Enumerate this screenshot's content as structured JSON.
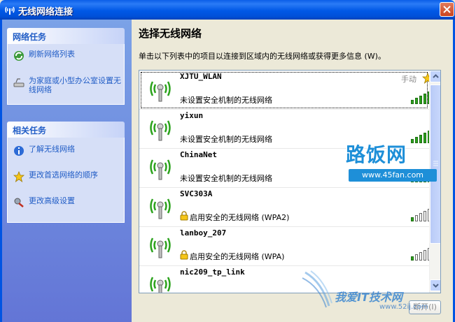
{
  "window": {
    "title": "无线网络连接"
  },
  "network_tasks": {
    "heading": "网络任务",
    "items": [
      {
        "label": "刷新网络列表",
        "icon": "refresh-icon"
      },
      {
        "label": "为家庭或小型办公室设置无线网络",
        "icon": "setup-network-icon"
      }
    ]
  },
  "related_tasks": {
    "heading": "相关任务",
    "items": [
      {
        "label": "了解无线网络",
        "icon": "info-icon"
      },
      {
        "label": "更改首选网络的顺序",
        "icon": "star-icon"
      },
      {
        "label": "更改高级设置",
        "icon": "settings-icon"
      }
    ]
  },
  "main": {
    "title": "选择无线网络",
    "description": "单击以下列表中的项目以连接到区域内的无线网络或获得更多信息 (W)。"
  },
  "networks": [
    {
      "ssid": "XJTU_WLAN",
      "security": "未设置安全机制的无线网络",
      "secured": false,
      "tag": "手动",
      "preferred": true,
      "signal_bars": 5,
      "selected": true
    },
    {
      "ssid": "yixun",
      "security": "未设置安全机制的无线网络",
      "secured": false,
      "signal_bars": 5
    },
    {
      "ssid": "ChinaNet",
      "security": "未设置安全机制的无线网络",
      "secured": false,
      "signal_bars": 5
    },
    {
      "ssid": "SVC303A",
      "security": "启用安全的无线网络 (WPA2)",
      "secured": true,
      "signal_bars": 1
    },
    {
      "ssid": "lanboy_207",
      "security": "启用安全的无线网络 (WPA)",
      "secured": true,
      "signal_bars": 1
    },
    {
      "ssid": "nic209_tp_link",
      "security": "",
      "secured": false,
      "signal_bars": 0
    }
  ],
  "buttons": {
    "connect": "断开(I)"
  },
  "watermarks": {
    "brand_cn": "路饭网",
    "brand_url": "www.45fan.com",
    "brand2_cn": "我爱IT技术网",
    "brand2_url": "www.52ij.com"
  },
  "colors": {
    "accent": "#0054E3",
    "link": "#215DC6",
    "signal_on": "#2BA21C"
  }
}
